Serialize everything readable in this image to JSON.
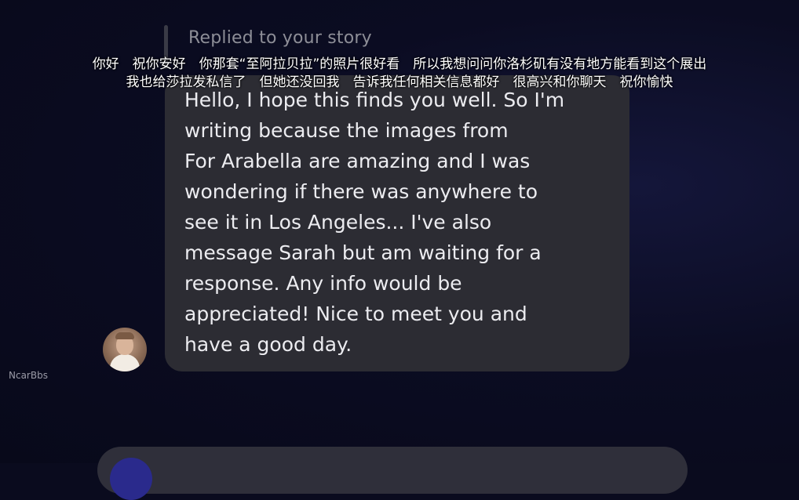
{
  "reply": {
    "header": "Replied to your story"
  },
  "subtitles": [
    "你好　祝你安好　你那套“至阿拉贝拉”的照片很好看　所以我想问问你洛杉矶有没有地方能看到这个展出",
    "我也给莎拉发私信了　但她还没回我　告诉我任何相关信息都好　很高兴和你聊天　祝你愉快"
  ],
  "message": {
    "lines": [
      "Hello, I hope this finds you well. So I'm",
      "writing because the images from",
      "For Arabella are amazing and I was",
      "wondering if there was anywhere to",
      "see it in Los Angeles... I've also",
      "message Sarah but am waiting for a",
      "response. Any info would be",
      "appreciated! Nice to meet you and",
      "have a good day."
    ]
  },
  "watermark": "NcarBbs",
  "colors": {
    "background": "#0a0b1e",
    "bubble": "#2c2c33",
    "accent": "#2a2a8c"
  }
}
